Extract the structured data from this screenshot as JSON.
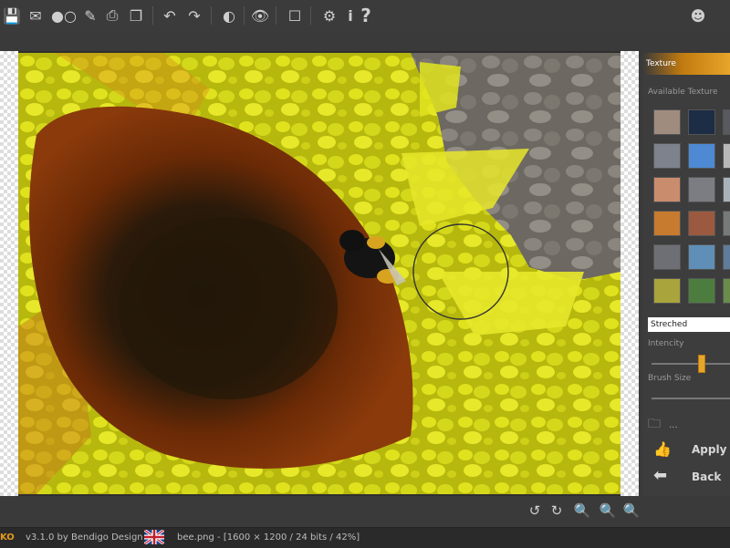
{
  "toolbar": {
    "icons": [
      "save-icon",
      "email-icon",
      "toggle-icon",
      "brush-icon",
      "print-icon",
      "copy-icon",
      "undo-icon",
      "redo-icon",
      "reset-icon",
      "view-icon",
      "frame-icon",
      "settings-icon",
      "info-icon",
      "help-icon",
      "smiley-icon"
    ]
  },
  "texture_panel": {
    "title": "Texture",
    "available_label": "Available Texture",
    "mode_value": "Streched",
    "intensity_label": "Intencity",
    "intensity_level": 0.65,
    "brush_size_label": "Brush Size",
    "folder_label": "...",
    "apply_label": "Apply",
    "back_label": "Back",
    "thumb_colors": [
      "#a08c7e",
      "#1d2d46",
      "#585a60",
      "#7d828c",
      "#4d8ad3",
      "#b8b8b8",
      "#c98c6d",
      "#7c7d82",
      "#a8b2bb",
      "#c67b2e",
      "#9b5a3f",
      "#767a78",
      "#6e6f75",
      "#5f8fb6",
      "#5f7c9a",
      "#a9a43c",
      "#4c7d3e",
      "#6b8b4a"
    ]
  },
  "nav": {
    "icons": [
      "rotate-left-icon",
      "rotate-right-icon",
      "zoom-in-icon",
      "zoom-out-icon",
      "zoom-fit-icon"
    ]
  },
  "status": {
    "app_name": "KO",
    "version": "v3.1.0 by Bendigo Design",
    "file_info": "bee.png - [1600 × 1200 / 24 bits / 42%]"
  }
}
